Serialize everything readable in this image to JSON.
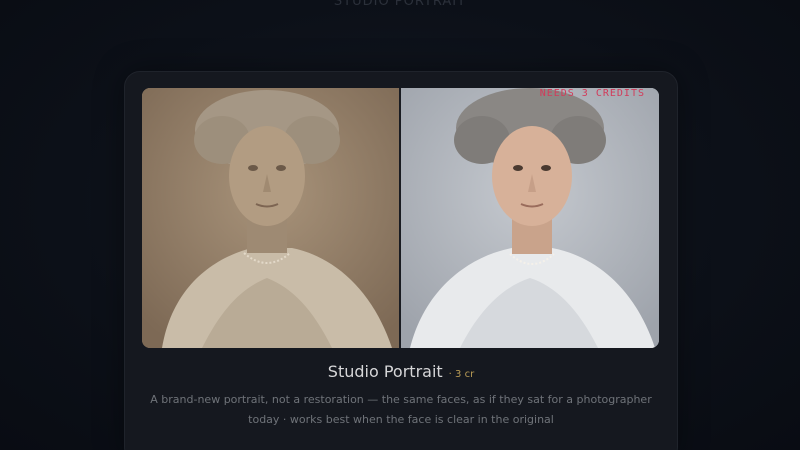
{
  "header": {
    "title": "STUDIO PORTRAIT"
  },
  "card": {
    "badge": "NEEDS 3 CREDITS",
    "title": "Studio Portrait",
    "cost": "· 3 cr",
    "description": "A brand-new portrait, not a restoration — the same faces, as if they sat for a photographer today · works best when the face is clear in the original"
  },
  "colors": {
    "page_bg": "#0b0f17",
    "card_bg": "#15181f",
    "badge": "#d23b5a",
    "cost": "#b99b55",
    "title": "#d6d6d8",
    "description": "#6f7379"
  },
  "images": {
    "before": "sepia-portrait",
    "after": "colorized-portrait"
  }
}
